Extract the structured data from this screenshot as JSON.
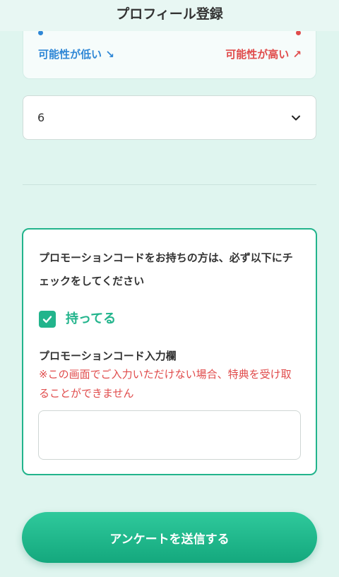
{
  "header": {
    "title": "プロフィール登録"
  },
  "likelihood_scale": {
    "low_label": "可能性が低い ↘",
    "high_label": "可能性が高い ↗"
  },
  "select": {
    "value": "6",
    "icon": "chevron-down-icon"
  },
  "promo": {
    "intro": "プロモーションコードをお持ちの方は、必ず以下にチェックをしてください",
    "checkbox_label": "持ってる",
    "checkbox_checked": true,
    "field_label": "プロモーションコード入力欄",
    "field_note": "※この画面でご入力いただけない場合、特典を受け取ることができません",
    "input_value": ""
  },
  "submit": {
    "label": "アンケートを送信する"
  },
  "colors": {
    "accent": "#22b48c",
    "background": "#dff5ef",
    "low": "#2f87d6",
    "high": "#e04b4b"
  }
}
